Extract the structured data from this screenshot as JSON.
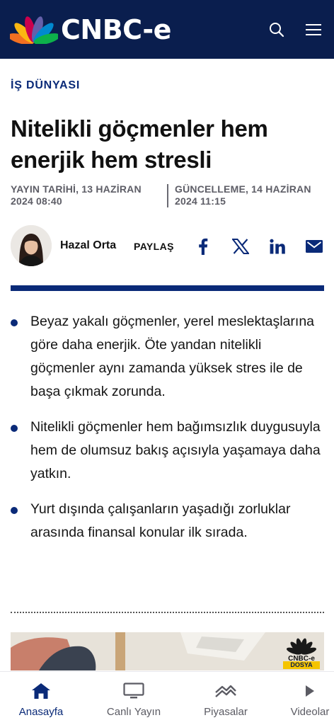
{
  "header": {
    "brand": "CNBC-e",
    "search_icon": "search-icon",
    "menu_icon": "hamburger-menu-icon",
    "background_color": "#0a1e4e"
  },
  "article": {
    "section": "İŞ DÜNYASI",
    "title": "Nitelikli göçmenler hem enerjik hem stresli",
    "published_line1": "YAYIN TARİHİ, 13 HAZİRAN",
    "published_line2": "2024 08:40",
    "updated_line1": "GÜNCELLEME, 14 HAZİRAN",
    "updated_line2": "2024 11:15",
    "author": "Hazal Orta",
    "share_label": "PAYLAŞ",
    "share_icons": [
      "facebook-icon",
      "x-icon",
      "linkedin-icon",
      "mail-icon"
    ],
    "bullets": [
      "Beyaz yakalı göçmenler, yerel meslektaşlarına göre daha enerjik. Öte yandan nitelikli göçmenler aynı zamanda yüksek stres ile de başa çıkmak zorunda.",
      "Nitelikli göçmenler hem bağımsızlık duygusuyla hem de olumsuz bakış açısıyla yaşamaya daha yatkın.",
      "Yurt dışında çalışanların yaşadığı zorluklar arasında finansal konular ilk sırada."
    ],
    "image_badge_brand": "CNBC-e",
    "image_badge_label": "DOSYA",
    "accent_color": "#0a2a78"
  },
  "bottom_nav": {
    "items": [
      {
        "label": "Anasayfa",
        "icon": "home-icon",
        "active": true
      },
      {
        "label": "Canlı Yayın",
        "icon": "tv-icon",
        "active": false
      },
      {
        "label": "Piyasalar",
        "icon": "markets-icon",
        "active": false
      },
      {
        "label": "Videolar",
        "icon": "play-icon",
        "active": false
      }
    ]
  }
}
